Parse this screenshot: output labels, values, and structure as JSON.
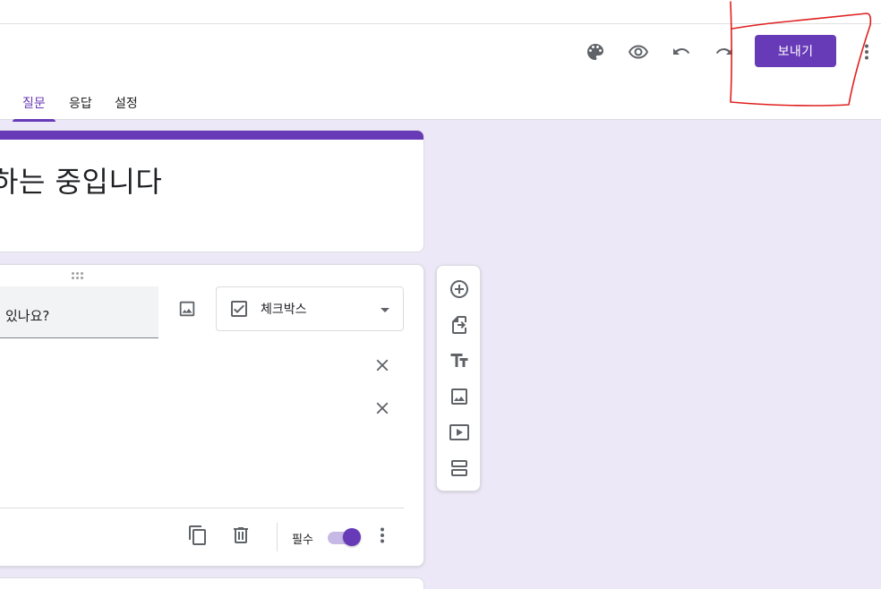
{
  "header": {
    "send_label": "보내기",
    "icons": [
      "palette-icon",
      "eye-icon",
      "undo-icon",
      "redo-icon",
      "more-vert-icon"
    ]
  },
  "tabs": [
    {
      "label": "질문",
      "active": true
    },
    {
      "label": "응답",
      "active": false
    },
    {
      "label": "설정",
      "active": false
    }
  ],
  "title_card": {
    "title": "하는 중입니다"
  },
  "question_card": {
    "question_text": "있나요?",
    "type_label": "체크박스",
    "required_label": "필수",
    "required_on": true
  },
  "side_toolbar": {
    "tools": [
      "add-question-icon",
      "import-questions-icon",
      "add-title-icon",
      "add-image-icon",
      "add-video-icon",
      "add-section-icon"
    ]
  },
  "colors": {
    "accent": "#673ab7",
    "background": "#ede8f7",
    "annotation": "#e02020"
  }
}
